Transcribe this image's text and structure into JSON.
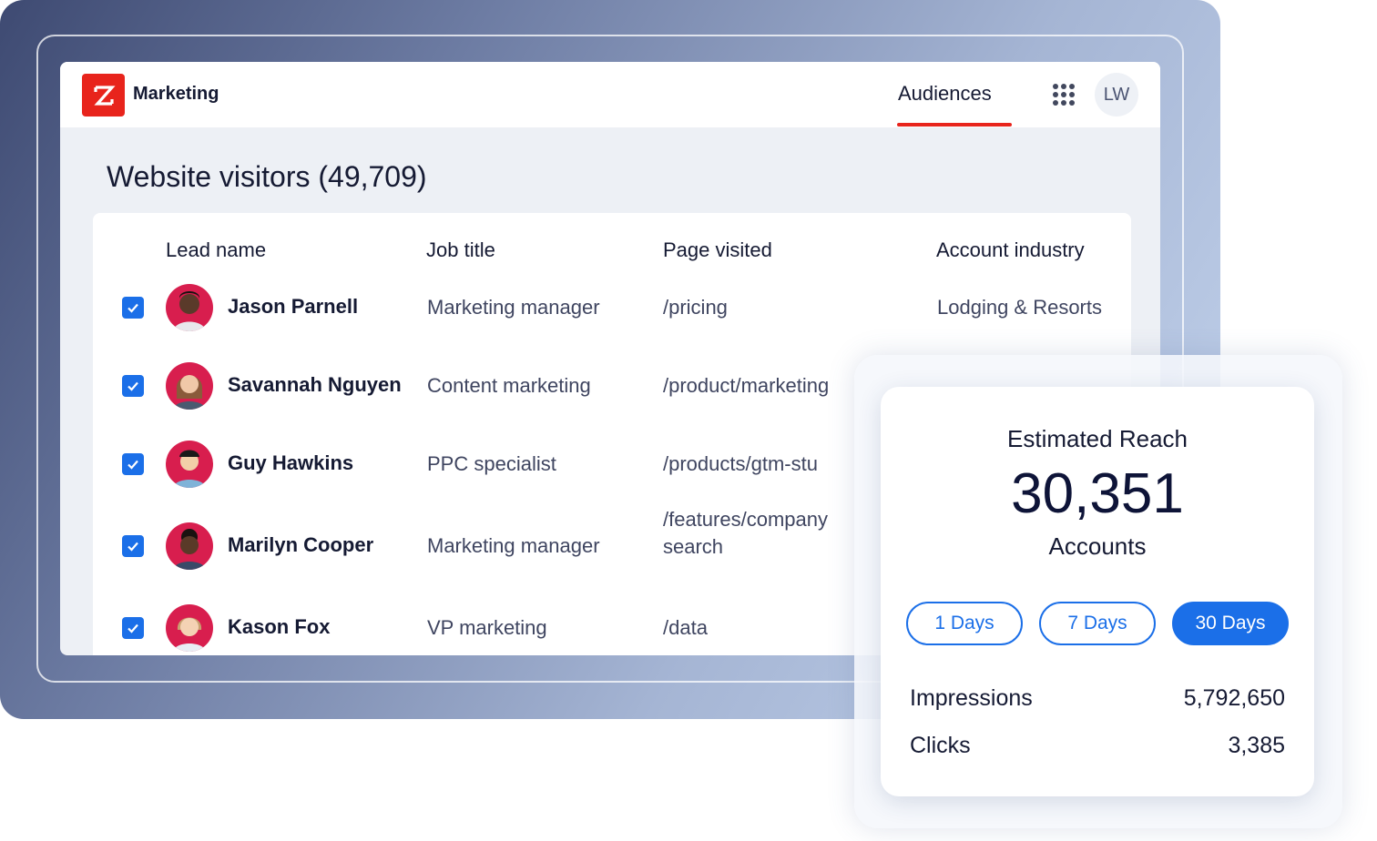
{
  "app": {
    "brand": "Marketing"
  },
  "header": {
    "tab": "Audiences",
    "user_initials": "LW"
  },
  "page": {
    "title": "Website visitors (49,709)"
  },
  "table": {
    "columns": [
      "Lead name",
      "Job title",
      "Page visited",
      "Account industry"
    ],
    "rows": [
      {
        "name": "Jason Parnell",
        "job": "Marketing manager",
        "page": "/pricing",
        "industry": "Lodging & Resorts",
        "checked": true
      },
      {
        "name": "Savannah Nguyen",
        "job": "Content marketing",
        "page": "/product/marketing",
        "industry": "",
        "checked": true
      },
      {
        "name": "Guy Hawkins",
        "job": "PPC specialist",
        "page": "/products/gtm-stu",
        "industry": "",
        "checked": true
      },
      {
        "name": "Marilyn Cooper",
        "job": "Marketing manager",
        "page": "/features/company",
        "page_line2": "search",
        "industry": "",
        "checked": true
      },
      {
        "name": "Kason Fox",
        "job": "VP marketing",
        "page": "/data",
        "industry": "",
        "checked": true
      }
    ]
  },
  "reach": {
    "title": "Estimated Reach",
    "value": "30,351",
    "unit": "Accounts",
    "ranges": [
      "1 Days",
      "7 Days",
      "30 Days"
    ],
    "active_range": "30 Days",
    "stats": [
      {
        "label": "Impressions",
        "value": "5,792,650"
      },
      {
        "label": "Clicks",
        "value": "3,385"
      }
    ]
  },
  "colors": {
    "accent": "#1b6fe8",
    "brand": "#e8241c",
    "avatar_bg": "#d81e4e"
  }
}
